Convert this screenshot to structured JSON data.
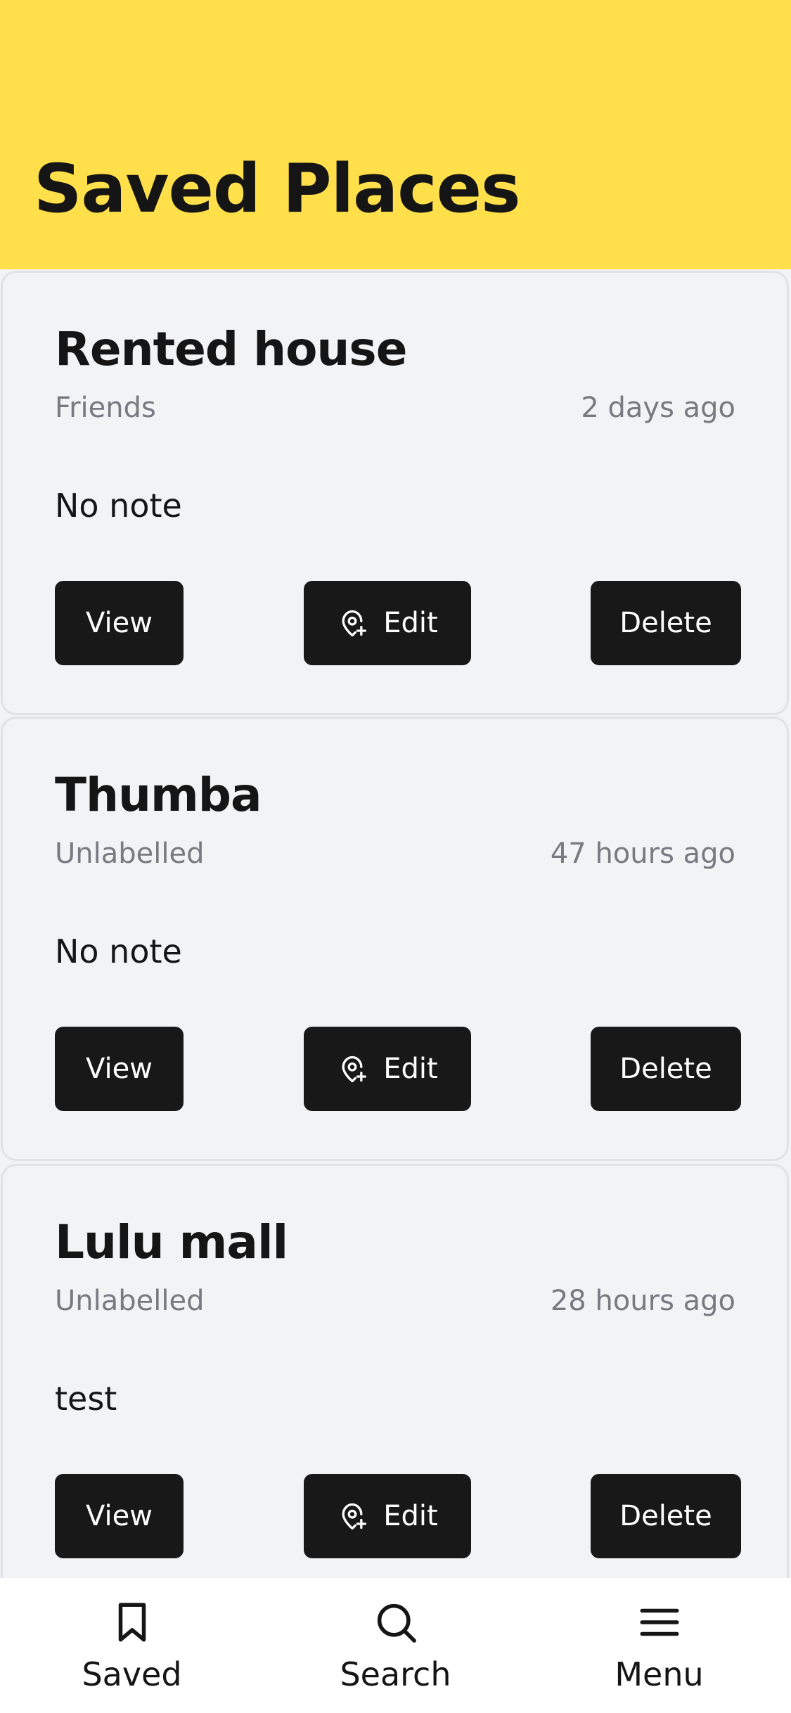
{
  "header": {
    "title": "Saved Places"
  },
  "places": [
    {
      "name": "Rented house",
      "label": "Friends",
      "time": "2 days ago",
      "note": "No note",
      "view_label": "View",
      "edit_label": "Edit",
      "delete_label": "Delete"
    },
    {
      "name": "Thumba",
      "label": "Unlabelled",
      "time": "47 hours ago",
      "note": "No note",
      "view_label": "View",
      "edit_label": "Edit",
      "delete_label": "Delete"
    },
    {
      "name": "Lulu mall",
      "label": "Unlabelled",
      "time": "28 hours ago",
      "note": "test",
      "view_label": "View",
      "edit_label": "Edit",
      "delete_label": "Delete"
    }
  ],
  "nav": {
    "items": [
      {
        "label": "Saved",
        "icon": "bookmark-icon"
      },
      {
        "label": "Search",
        "icon": "search-icon"
      },
      {
        "label": "Menu",
        "icon": "menu-icon"
      }
    ]
  },
  "colors": {
    "header_bg": "#ffe04b",
    "card_bg": "#f2f3f5",
    "button_bg": "#181818",
    "muted_text": "#777a80"
  }
}
